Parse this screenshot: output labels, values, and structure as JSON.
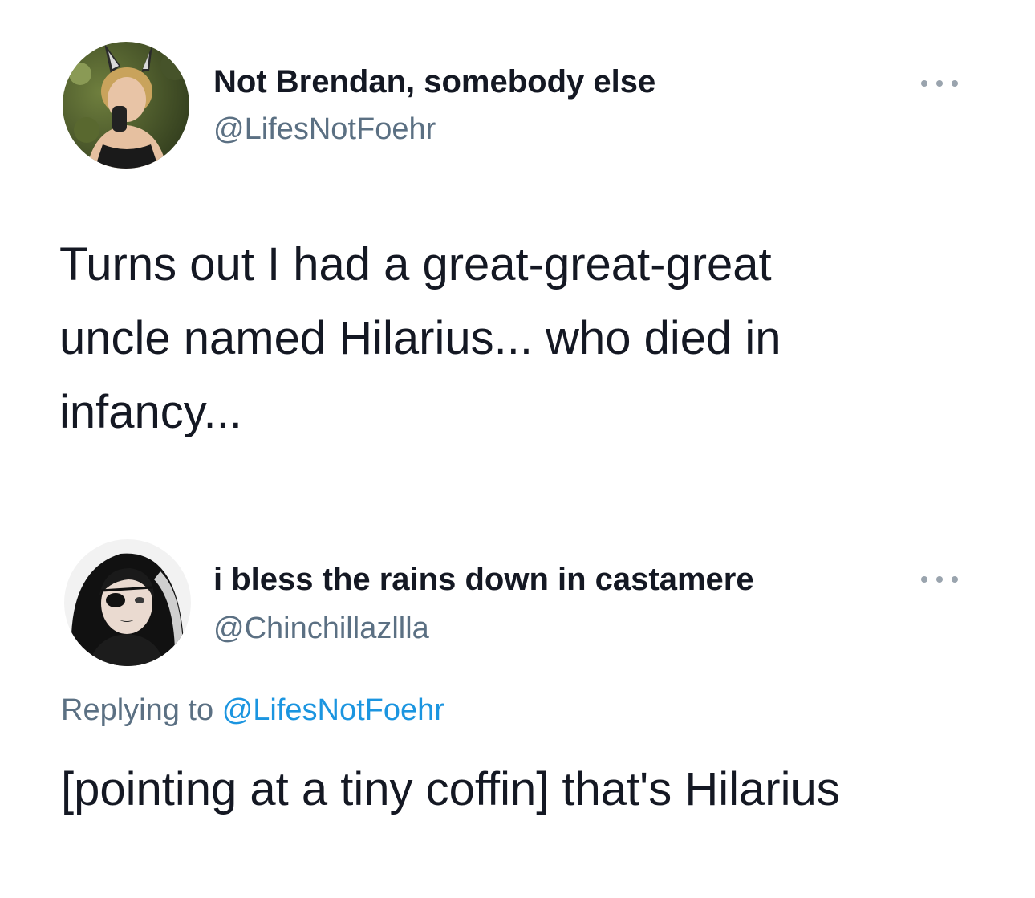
{
  "tweets": [
    {
      "display_name": "Not Brendan, somebody else",
      "handle": "@LifesNotFoehr",
      "avatar_icon": "user-avatar",
      "text_lines": [
        "Turns out I had a great-great-great",
        "uncle named Hilarius... who died in",
        "infancy..."
      ]
    },
    {
      "display_name": "i bless the rains down in castamere",
      "handle": "@Chinchillazllla",
      "avatar_icon": "user-avatar",
      "replying_prefix": "Replying to",
      "replying_mention": "@LifesNotFoehr",
      "text": "[pointing at a tiny coffin] that's Hilarius"
    }
  ],
  "colors": {
    "text": "#141823",
    "secondary": "#5b7083",
    "link": "#1b95e0",
    "more_dots": "#9aa4ae"
  }
}
